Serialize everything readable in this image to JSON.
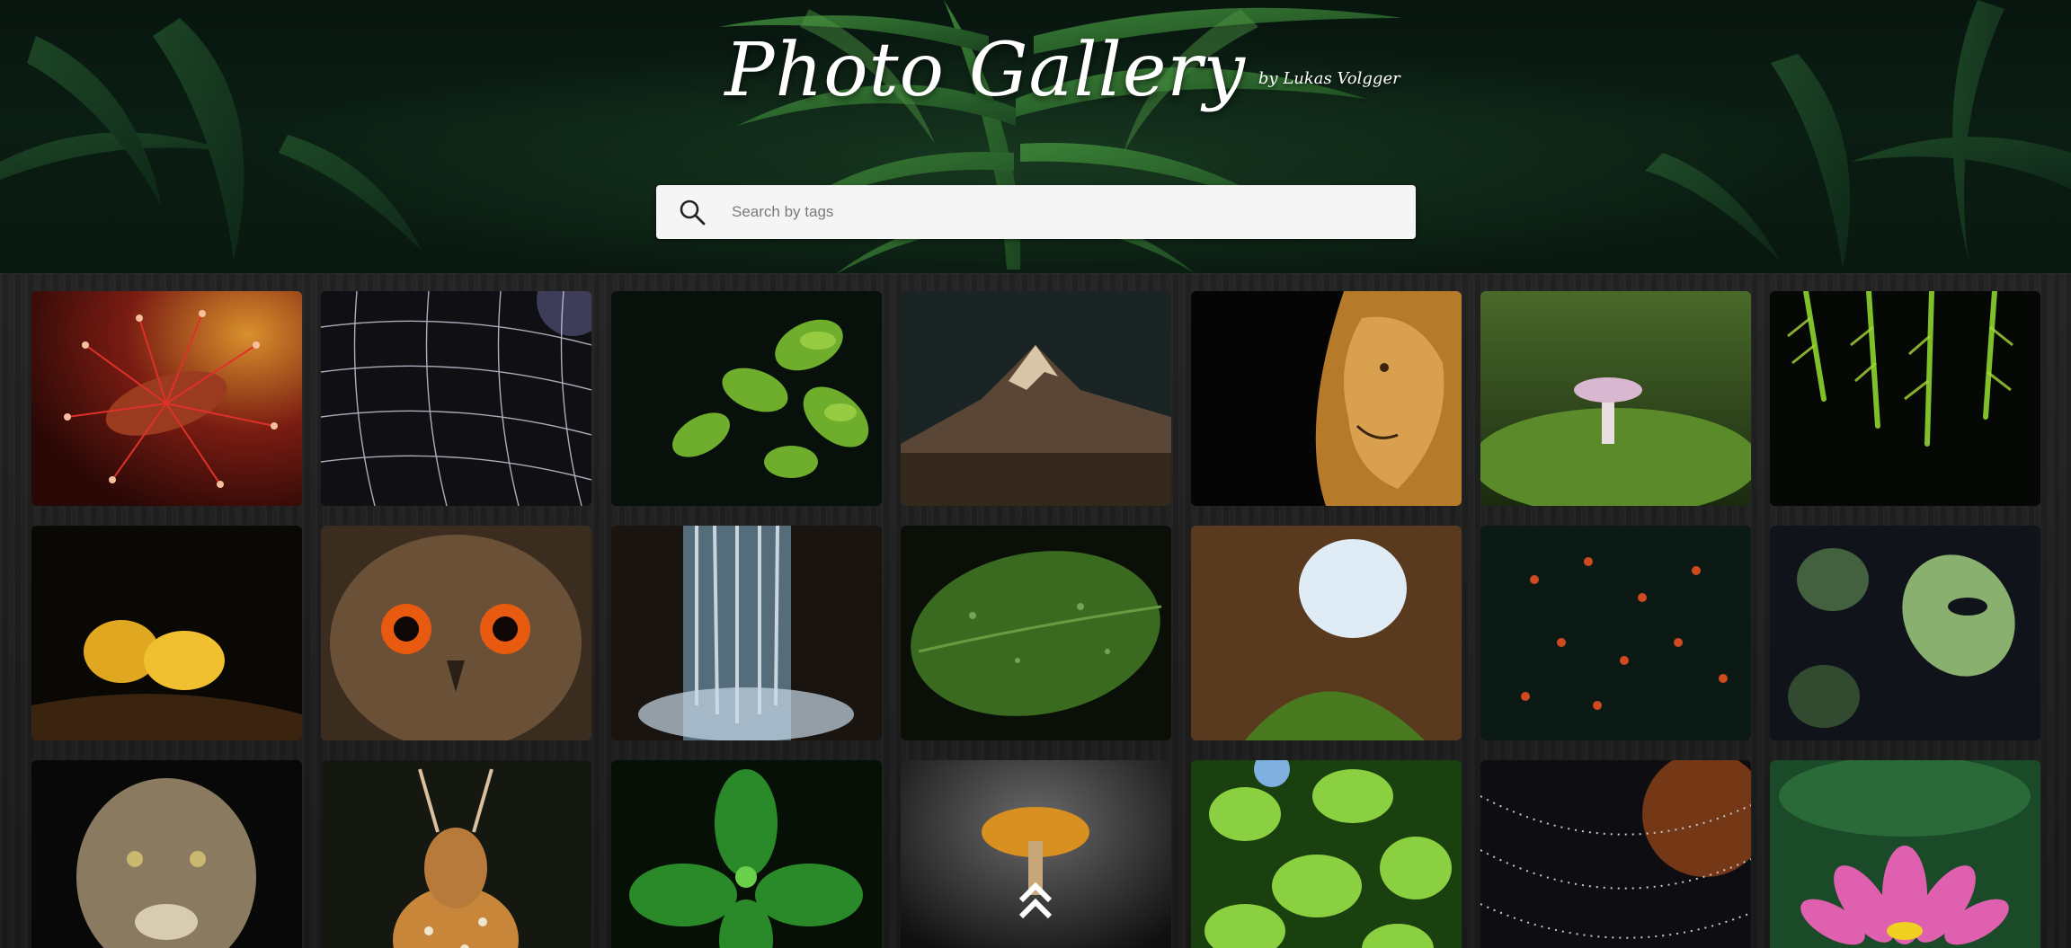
{
  "header": {
    "title": "Photo Gallery",
    "byline": "by Lukas Volgger"
  },
  "search": {
    "placeholder": "Search by tags",
    "value": ""
  },
  "icons": {
    "search": "search-icon",
    "scroll_top": "double-chevron-up-icon"
  },
  "gallery": {
    "photos": [
      {
        "subject": "sundew",
        "name": "photo-sundew"
      },
      {
        "subject": "spider web",
        "name": "photo-spider-web"
      },
      {
        "subject": "green leaves",
        "name": "photo-green-leaves"
      },
      {
        "subject": "mountain",
        "name": "photo-mountain"
      },
      {
        "subject": "lion",
        "name": "photo-lion"
      },
      {
        "subject": "mushroom",
        "name": "photo-mushroom"
      },
      {
        "subject": "fern",
        "name": "photo-fern"
      },
      {
        "subject": "lantern fruit",
        "name": "photo-lantern-fruit"
      },
      {
        "subject": "owl",
        "name": "photo-owl"
      },
      {
        "subject": "waterfall",
        "name": "photo-waterfall"
      },
      {
        "subject": "leaf with drops",
        "name": "photo-leaf-drops"
      },
      {
        "subject": "cave",
        "name": "photo-cave"
      },
      {
        "subject": "berries",
        "name": "photo-berries"
      },
      {
        "subject": "monstera",
        "name": "photo-monstera"
      },
      {
        "subject": "cougar",
        "name": "photo-cougar"
      },
      {
        "subject": "deer",
        "name": "photo-deer"
      },
      {
        "subject": "nettle",
        "name": "photo-nettle"
      },
      {
        "subject": "orange mushroom",
        "name": "photo-orange-mushroom"
      },
      {
        "subject": "sunlit leaves",
        "name": "photo-sunlit-leaves"
      },
      {
        "subject": "dew web",
        "name": "photo-dew-web"
      },
      {
        "subject": "lotus",
        "name": "photo-lotus"
      }
    ]
  },
  "colors": {
    "search_bg": "#f5f5f5",
    "gallery_bg": "#1c1c1c",
    "header_bg": "#0d2417"
  }
}
